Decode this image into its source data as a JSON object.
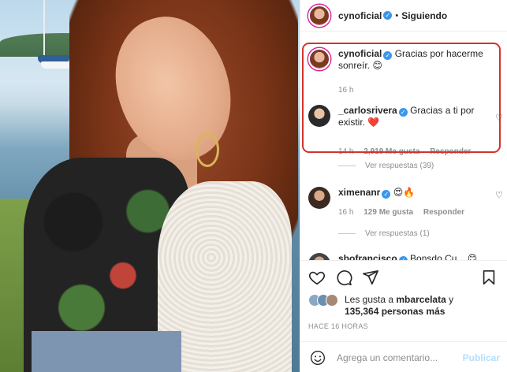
{
  "header": {
    "username": "cynoficial",
    "follow_status": "Siguiendo",
    "separator": "•"
  },
  "comments": [
    {
      "username": "cynoficial",
      "text": "Gracias por hacerme sonreír. 😊",
      "time": "16 h"
    },
    {
      "username": "_carlosrivera",
      "text": "Gracias a ti por existir. ❤️",
      "time": "14 h",
      "likes": "2,919 Me gusta",
      "reply": "Responder",
      "view_replies": "Ver respuestas (39)"
    },
    {
      "username": "ximenanr",
      "text": "😍🔥",
      "time": "16 h",
      "likes": "129 Me gusta",
      "reply": "Responder",
      "view_replies": "Ver respuestas (1)"
    },
    {
      "username": "sbofrancisco",
      "text": "Bonsdo Cu... 😊"
    }
  ],
  "post": {
    "likes_prefix": "Les gusta a",
    "likes_user": "mbarcelata",
    "likes_suffix": "y",
    "likes_count": "135,364 personas más",
    "timestamp": "HACE 16 HORAS"
  },
  "composer": {
    "placeholder": "Agrega un comentario...",
    "publish_label": "Publicar"
  },
  "icons": {
    "like": "heart-icon",
    "comment": "comment-icon",
    "share": "share-icon",
    "save": "bookmark-icon",
    "emoji": "emoji-icon"
  },
  "colors": {
    "verified": "#3897f0",
    "highlight": "#d0342c",
    "publish_disabled": "#b2dffc",
    "heart_red": "#ed4956"
  }
}
